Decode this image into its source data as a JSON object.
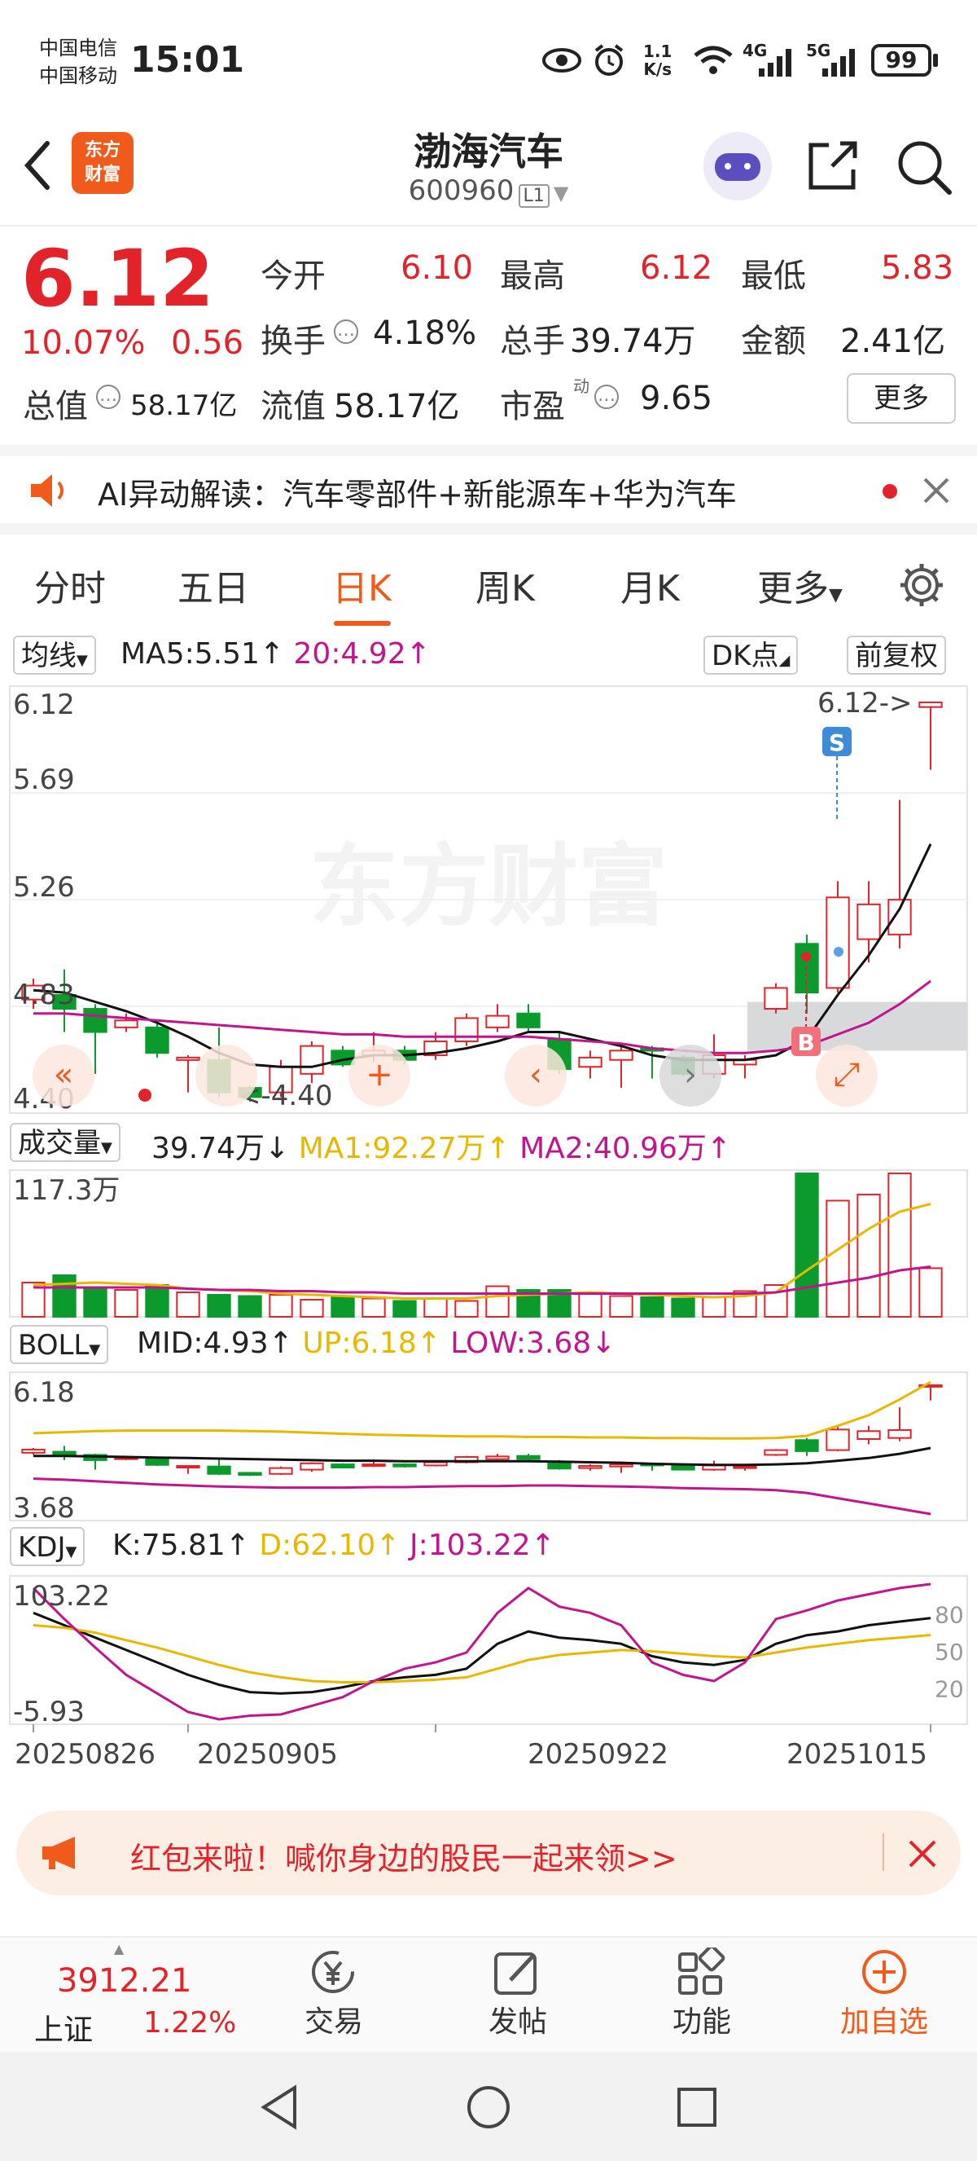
{
  "status_bar": {
    "carrier1": "中国电信",
    "carrier2": "中国移动",
    "time": "15:01",
    "net_speed_top": "1.1",
    "net_speed_bottom": "K/s",
    "net_4g": "4G",
    "net_5g": "5G",
    "battery": "99"
  },
  "header": {
    "logo_line1": "东方",
    "logo_line2": "财富",
    "title": "渤海汽车",
    "code": "600960",
    "level": "L1"
  },
  "quote": {
    "price": "6.12",
    "change_pct": "10.07%",
    "change_abs": "0.56",
    "open_label": "今开",
    "open": "6.10",
    "high_label": "最高",
    "high": "6.12",
    "low_label": "最低",
    "low": "5.83",
    "turnover_label": "换手",
    "turnover": "4.18%",
    "volume_label": "总手",
    "volume": "39.74万",
    "amount_label": "金额",
    "amount": "2.41亿",
    "mcap_label": "总值",
    "mcap": "58.17亿",
    "float_label": "流值",
    "float": "58.17亿",
    "pe_label": "市盈",
    "pe_sup": "动",
    "pe": "9.65",
    "more": "更多"
  },
  "ai_bar": {
    "text": "AI异动解读：汽车零部件+新能源车+华为汽车"
  },
  "tabs": [
    "分时",
    "五日",
    "日K",
    "周K",
    "月K",
    "更多"
  ],
  "active_tab": 2,
  "kline": {
    "indicator": "均线",
    "ma5": "MA5:5.51",
    "ma20": "20:4.92",
    "dk_label": "DK点",
    "restore_label": "前复权",
    "y_labels": [
      "6.12",
      "5.69",
      "5.26",
      "4.83",
      "4.40"
    ],
    "max_annot": "6.12->",
    "min_annot": "<-4.40",
    "sell_mark": "S",
    "buy_mark": "B",
    "watermark": "东方财富"
  },
  "volume": {
    "label": "成交量",
    "value": "39.74万",
    "ma1": "MA1:92.27万",
    "ma2": "MA2:40.96万",
    "y_top": "117.3万"
  },
  "boll": {
    "label": "BOLL",
    "mid": "MID:4.93",
    "up": "UP:6.18",
    "low": "LOW:3.68",
    "y_top": "6.18",
    "y_bottom": "3.68"
  },
  "kdj": {
    "label": "KDJ",
    "k": "K:75.81",
    "d": "D:62.10",
    "j": "J:103.22",
    "y_top": "103.22",
    "y_bottom": "-5.93",
    "r80": "80",
    "r50": "50",
    "r20": "20"
  },
  "dates": [
    "20250826",
    "20250905",
    "20250922",
    "20251015"
  ],
  "chart_data": {
    "type": "candlestick",
    "ylim": [
      4.4,
      6.12
    ],
    "candles": [
      {
        "o": 4.84,
        "c": 4.9,
        "h": 4.93,
        "l": 4.8,
        "up": true
      },
      {
        "o": 4.86,
        "c": 4.8,
        "h": 4.97,
        "l": 4.7,
        "up": false
      },
      {
        "o": 4.8,
        "c": 4.7,
        "h": 4.82,
        "l": 4.52,
        "up": false
      },
      {
        "o": 4.72,
        "c": 4.75,
        "h": 4.78,
        "l": 4.7,
        "up": true
      },
      {
        "o": 4.72,
        "c": 4.61,
        "h": 4.74,
        "l": 4.59,
        "up": false
      },
      {
        "o": 4.58,
        "c": 4.59,
        "h": 4.6,
        "l": 4.44,
        "up": true
      },
      {
        "o": 4.58,
        "c": 4.44,
        "h": 4.72,
        "l": 4.42,
        "up": false
      },
      {
        "o": 4.46,
        "c": 4.42,
        "h": 4.47,
        "l": 4.4,
        "up": false
      },
      {
        "o": 4.44,
        "c": 4.55,
        "h": 4.58,
        "l": 4.42,
        "up": true
      },
      {
        "o": 4.52,
        "c": 4.64,
        "h": 4.66,
        "l": 4.48,
        "up": true
      },
      {
        "o": 4.62,
        "c": 4.56,
        "h": 4.64,
        "l": 4.55,
        "up": false
      },
      {
        "o": 4.6,
        "c": 4.62,
        "h": 4.7,
        "l": 4.57,
        "up": true
      },
      {
        "o": 4.62,
        "c": 4.58,
        "h": 4.64,
        "l": 4.56,
        "up": false
      },
      {
        "o": 4.6,
        "c": 4.66,
        "h": 4.7,
        "l": 4.58,
        "up": true
      },
      {
        "o": 4.66,
        "c": 4.76,
        "h": 4.78,
        "l": 4.64,
        "up": true
      },
      {
        "o": 4.72,
        "c": 4.77,
        "h": 4.82,
        "l": 4.7,
        "up": true
      },
      {
        "o": 4.78,
        "c": 4.72,
        "h": 4.82,
        "l": 4.7,
        "up": false
      },
      {
        "o": 4.67,
        "c": 4.54,
        "h": 4.7,
        "l": 4.52,
        "up": false
      },
      {
        "o": 4.55,
        "c": 4.59,
        "h": 4.62,
        "l": 4.5,
        "up": true
      },
      {
        "o": 4.58,
        "c": 4.62,
        "h": 4.64,
        "l": 4.46,
        "up": true
      },
      {
        "o": 4.63,
        "c": 4.62,
        "h": 4.64,
        "l": 4.5,
        "up": false
      },
      {
        "o": 4.59,
        "c": 4.52,
        "h": 4.6,
        "l": 4.51,
        "up": false
      },
      {
        "o": 4.52,
        "c": 4.6,
        "h": 4.69,
        "l": 4.5,
        "up": true
      },
      {
        "o": 4.56,
        "c": 4.58,
        "h": 4.6,
        "l": 4.5,
        "up": true
      },
      {
        "o": 4.8,
        "c": 4.89,
        "h": 4.91,
        "l": 4.78,
        "up": true
      },
      {
        "o": 5.08,
        "c": 4.87,
        "h": 5.12,
        "l": 4.78,
        "up": false
      },
      {
        "o": 4.89,
        "c": 5.28,
        "h": 5.35,
        "l": 4.87,
        "up": true
      },
      {
        "o": 5.1,
        "c": 5.25,
        "h": 5.35,
        "l": 5.0,
        "up": true
      },
      {
        "o": 5.12,
        "c": 5.27,
        "h": 5.7,
        "l": 5.06,
        "up": true
      },
      {
        "o": 6.1,
        "c": 6.12,
        "h": 6.12,
        "l": 5.83,
        "up": true
      }
    ],
    "ma5": [
      4.88,
      4.87,
      4.83,
      4.79,
      4.74,
      4.68,
      4.61,
      4.56,
      4.55,
      4.55,
      4.58,
      4.6,
      4.6,
      4.61,
      4.63,
      4.66,
      4.7,
      4.7,
      4.67,
      4.64,
      4.6,
      4.58,
      4.58,
      4.58,
      4.6,
      4.67,
      4.86,
      5.03,
      5.23,
      5.51
    ],
    "ma20": [
      4.78,
      4.78,
      4.77,
      4.76,
      4.75,
      4.74,
      4.73,
      4.72,
      4.71,
      4.7,
      4.69,
      4.69,
      4.68,
      4.68,
      4.68,
      4.68,
      4.68,
      4.67,
      4.66,
      4.65,
      4.63,
      4.62,
      4.61,
      4.61,
      4.62,
      4.64,
      4.69,
      4.74,
      4.82,
      4.92
    ],
    "volume_wan": [
      28,
      34,
      24,
      22,
      26,
      20,
      18,
      17,
      18,
      14,
      16,
      15,
      13,
      15,
      13,
      25,
      22,
      22,
      20,
      17,
      16,
      15,
      16,
      21,
      26,
      117.3,
      95,
      100,
      117.3,
      39.74
    ],
    "vol_ma1": [
      26,
      27,
      28,
      27,
      26,
      23,
      22,
      21,
      19,
      18,
      17,
      16,
      15,
      15,
      15,
      17,
      18,
      19,
      20,
      19,
      18,
      17,
      16,
      17,
      20,
      38,
      55,
      72,
      86,
      92.27
    ],
    "vol_ma2": [
      24,
      24,
      24,
      24,
      24,
      23,
      22,
      22,
      21,
      21,
      20,
      20,
      19,
      19,
      19,
      19,
      19,
      19,
      19,
      19,
      19,
      19,
      19,
      19,
      20,
      24,
      28,
      32,
      38,
      40.96
    ],
    "boll_up": [
      5.21,
      5.23,
      5.25,
      5.26,
      5.26,
      5.26,
      5.26,
      5.25,
      5.24,
      5.22,
      5.2,
      5.18,
      5.17,
      5.16,
      5.15,
      5.15,
      5.14,
      5.14,
      5.13,
      5.13,
      5.12,
      5.12,
      5.11,
      5.11,
      5.12,
      5.16,
      5.35,
      5.55,
      5.85,
      6.18
    ],
    "boll_mid": [
      4.78,
      4.78,
      4.77,
      4.76,
      4.75,
      4.74,
      4.73,
      4.72,
      4.71,
      4.7,
      4.69,
      4.69,
      4.68,
      4.68,
      4.68,
      4.68,
      4.68,
      4.67,
      4.66,
      4.65,
      4.63,
      4.62,
      4.61,
      4.61,
      4.62,
      4.64,
      4.69,
      4.74,
      4.82,
      4.93
    ],
    "boll_low": [
      4.35,
      4.33,
      4.3,
      4.27,
      4.24,
      4.22,
      4.2,
      4.19,
      4.18,
      4.18,
      4.18,
      4.19,
      4.19,
      4.2,
      4.21,
      4.21,
      4.22,
      4.22,
      4.21,
      4.2,
      4.19,
      4.17,
      4.16,
      4.15,
      4.13,
      4.08,
      3.98,
      3.88,
      3.78,
      3.68
    ],
    "kdj_k": [
      80,
      70,
      60,
      50,
      40,
      30,
      22,
      16,
      15,
      16,
      20,
      25,
      28,
      30,
      35,
      55,
      65,
      60,
      58,
      55,
      45,
      40,
      38,
      42,
      55,
      62,
      65,
      70,
      73,
      75.81
    ],
    "kdj_d": [
      70,
      68,
      64,
      58,
      52,
      45,
      38,
      32,
      28,
      25,
      24,
      24,
      25,
      26,
      28,
      35,
      42,
      46,
      48,
      50,
      49,
      47,
      45,
      44,
      48,
      52,
      55,
      58,
      60,
      62.1
    ],
    "kdj_j": [
      100,
      75,
      52,
      30,
      15,
      0,
      -5.93,
      -3,
      -2,
      5,
      12,
      25,
      35,
      40,
      48,
      80,
      100,
      85,
      80,
      70,
      40,
      30,
      25,
      40,
      75,
      82,
      90,
      95,
      100,
      103.22
    ]
  },
  "banner": {
    "text": "红包来啦！喊你身边的股民一起来领>>"
  },
  "bottom": {
    "index_value": "3912.21",
    "index_name": "上证",
    "index_pct": "1.22%",
    "trade": "交易",
    "post": "发帖",
    "func": "功能",
    "add": "加自选"
  },
  "colors": {
    "up": "#e2232a",
    "down": "#0a9b2c",
    "accent": "#f05a1a",
    "ma5": "#111111",
    "ma20": "#c1148e",
    "yellow": "#e8b800"
  }
}
